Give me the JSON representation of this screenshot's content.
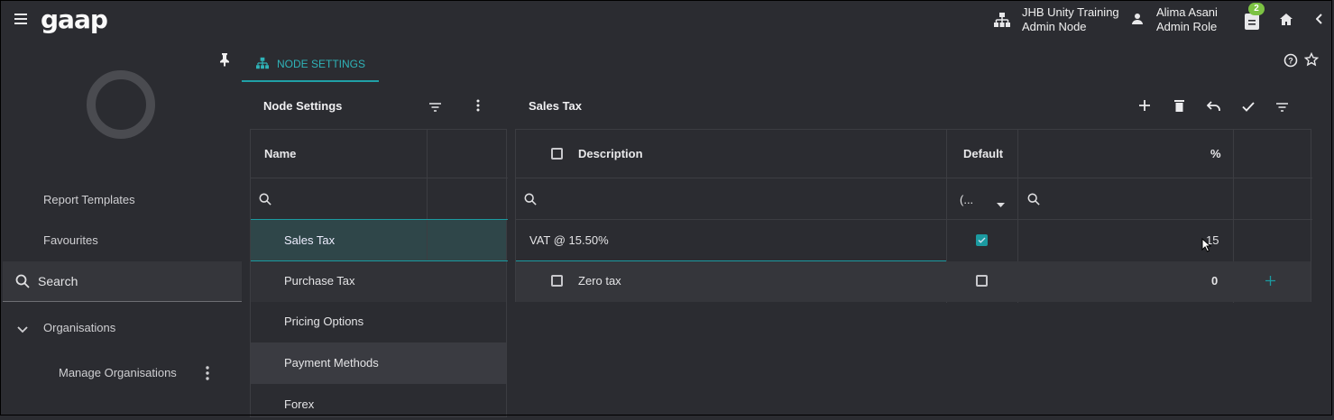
{
  "app": {
    "logo": "gaap",
    "node_name": "JHB Unity Training",
    "node_role": "Admin Node",
    "user_name": "Alima Asani",
    "user_role": "Admin Role",
    "notifications_count": "2"
  },
  "tab": {
    "label": "NODE SETTINGS"
  },
  "sidebar": {
    "items": [
      {
        "label": "Report Templates"
      },
      {
        "label": "Favourites"
      }
    ],
    "search_label": "Search",
    "organisations_label": "Organisations",
    "manage_label": "Manage Organisations"
  },
  "left_panel": {
    "title": "Node Settings",
    "column_name": "Name",
    "rows": [
      {
        "label": "Sales Tax"
      },
      {
        "label": "Purchase Tax"
      },
      {
        "label": "Pricing Options"
      },
      {
        "label": "Payment Methods"
      },
      {
        "label": "Forex"
      }
    ]
  },
  "right_panel": {
    "title": "Sales Tax",
    "columns": {
      "description": "Description",
      "default": "Default",
      "percent": "%"
    },
    "default_filter": "(...",
    "rows": [
      {
        "description": "VAT @ 15.50%",
        "default": true,
        "percent": "15"
      },
      {
        "description": "Zero tax",
        "default": false,
        "percent": "0"
      }
    ]
  },
  "colors": {
    "accent": "#1b9aa0",
    "badge": "#7cc243",
    "background": "#2b2c31"
  }
}
